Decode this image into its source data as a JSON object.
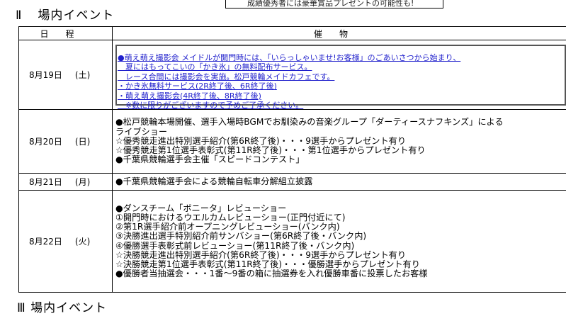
{
  "prev_row_text": "成績優秀者には豪華賞品プレゼントの可能性も!",
  "section": {
    "number": "Ⅱ",
    "title": "場内イベント"
  },
  "table": {
    "header_date": "日程",
    "header_content": "催物",
    "rows": [
      {
        "date": "8月19日",
        "dow": "(土)",
        "lines": [
          "●萌え萌え撮影会 メイドルが開門時には、「いらっしゃいませ!お客様」のごあいさつから始まり、",
          "　夏にはもってこいの「かき氷」の無料配布サービス。",
          "　レース合間には撮影会を実施。松戸競輪メイドカフェです。",
          "・かき氷無料サービス(2R終了後、6R終了後)",
          "・萌え萌え撮影会(4R終了後、8R終了後)",
          "　※数に限りがございますので予めご了承ください。"
        ]
      },
      {
        "date": "8月20日",
        "dow": "(日)",
        "lines": [
          "●松戸競輪本場開催、選手入場時BGMでお馴染みの音楽グループ「ダーティースナフキンズ」による",
          "ライブショー",
          "☆優秀競走進出特別選手紹介(第6R終了後)・・・9選手からプレゼント有り",
          "☆優秀競走第1位選手表彰式(第11R終了後)・・・第1位選手からプレゼント有り",
          "●千葉県競輪選手会主催「スピードコンテスト」"
        ]
      },
      {
        "date": "8月21日",
        "dow": "(月)",
        "lines": [
          "●千葉県競輪選手会による競輪自転車分解組立披露"
        ]
      },
      {
        "date": "8月22日",
        "dow": "(火)",
        "lines": [
          "●ダンスチーム「ボニータ」レビューショー",
          "①開門時におけるウエルカムレビューショー(正門付近にて)",
          "②第1R選手紹介前オープニングレビューショー(バンク内)",
          "③決勝進出選手特別紹介前サンバショー(第6R終了後・バンク内)",
          "④優勝選手表彰式前レビューショー(第11R終了後・バンク内)",
          "☆決勝競走進出特別選手紹介(第6R終了後)・・・9選手からプレゼント有り",
          "☆決勝競走第1位選手表彰式(第11R終了後)・・・優勝選手からプレゼント有り",
          "●優勝者当抽選会・・・1番〜9番の箱に抽選券を入れ優勝車番に投票したお客様"
        ]
      }
    ]
  },
  "next_section": {
    "number": "Ⅲ",
    "title": "場内イベント"
  }
}
